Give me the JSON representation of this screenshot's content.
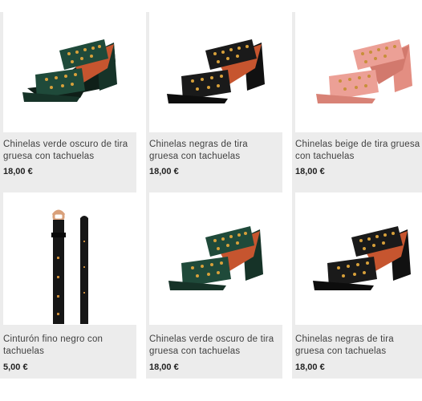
{
  "products": [
    {
      "name": "Chinelas verde oscuro de tira gruesa con tachuelas",
      "price": "18,00 €",
      "icon": "green-heel-sandal",
      "color": "#1f4a3a"
    },
    {
      "name": "Chinelas negras de tira gruesa con tachuelas",
      "price": "18,00 €",
      "icon": "black-heel-sandal",
      "color": "#1a1a1a"
    },
    {
      "name": "Chinelas beige de tira gruesa con tachuelas",
      "price": "18,00 €",
      "icon": "beige-heel-sandal",
      "color": "#e8948a"
    },
    {
      "name": "Cinturón fino negro con tachuelas",
      "price": "5,00 €",
      "icon": "black-belt",
      "color": "#1a1a1a"
    },
    {
      "name": "Chinelas verde oscuro de tira gruesa con tachuelas",
      "price": "18,00 €",
      "icon": "green-heel-sandal",
      "color": "#1f4a3a"
    },
    {
      "name": "Chinelas negras de tira gruesa con tachuelas",
      "price": "18,00 €",
      "icon": "black-heel-sandal",
      "color": "#1a1a1a"
    }
  ]
}
